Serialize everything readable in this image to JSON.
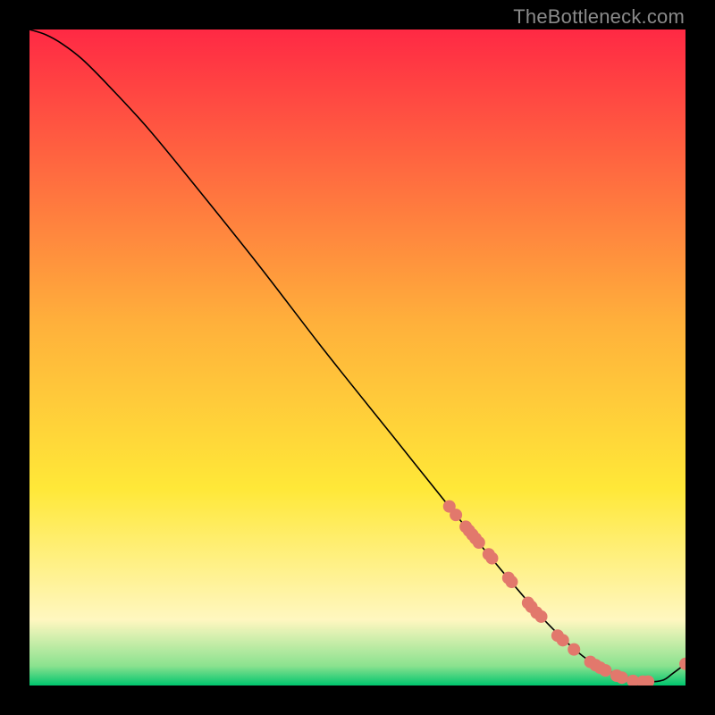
{
  "watermark": "TheBottleneck.com",
  "chart_data": {
    "type": "line",
    "title": "",
    "xlabel": "",
    "ylabel": "",
    "xlim": [
      0,
      100
    ],
    "ylim": [
      0,
      100
    ],
    "grid": false,
    "legend": false,
    "background_gradient": {
      "top": "#ff2944",
      "mid1": "#ffb13b",
      "mid2": "#ffe838",
      "mid3": "#fff7c0",
      "near_bottom": "#8be28f",
      "bottom": "#00c56e"
    },
    "series": [
      {
        "name": "curve",
        "color": "#000000",
        "x": [
          0,
          2.5,
          5,
          8,
          12,
          18,
          25,
          35,
          45,
          55,
          65,
          72,
          78,
          82,
          85,
          88,
          91,
          94,
          96.5,
          98,
          100
        ],
        "y": [
          100,
          99.2,
          97.8,
          95.5,
          91.5,
          85,
          76.5,
          64,
          51,
          38.5,
          26,
          17.5,
          10.5,
          6.5,
          4,
          2.3,
          1.2,
          0.6,
          0.8,
          1.8,
          3.3
        ]
      }
    ],
    "markers": {
      "name": "highlight-dots",
      "color": "#e2786c",
      "radius_px": 7,
      "x": [
        64,
        65,
        66.5,
        67,
        67.5,
        68,
        68.5,
        70,
        70.5,
        73,
        73.5,
        76,
        76.5,
        77.3,
        78,
        80.5,
        81.3,
        83,
        85.5,
        86.3,
        87,
        87.8,
        89.5,
        90.3,
        92,
        93.5,
        94.3,
        100
      ],
      "y": [
        27.3,
        26,
        24.2,
        23.6,
        23,
        22.4,
        21.8,
        20,
        19.4,
        16.4,
        15.8,
        12.6,
        12,
        11.1,
        10.5,
        7.6,
        6.9,
        5.5,
        3.6,
        3.1,
        2.7,
        2.3,
        1.5,
        1.2,
        0.7,
        0.6,
        0.6,
        3.3
      ]
    }
  }
}
